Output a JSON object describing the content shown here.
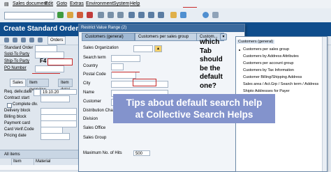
{
  "menubar": {
    "items": [
      "Sales document",
      "Edit",
      "Goto",
      "Extras",
      "Environment",
      "System",
      "Help"
    ]
  },
  "titlebar": {
    "title": "Create Standard Order: O..."
  },
  "app_toolbar": {
    "orders_label": "Orders"
  },
  "header_form": {
    "standard_order": "Standard Order",
    "sold_to": "Sold-To Party",
    "ship_to": "Ship-To Party",
    "po_number": "PO Number",
    "f4_hint": "F4"
  },
  "tabs": [
    "Sales",
    "Item overview",
    "Item detai"
  ],
  "sales_tab": {
    "req_deliv_date": "Req. deliv.date",
    "req_deliv_value": "19.10.20",
    "contract_start": "Contract start",
    "complete_dlv": "Complete dlv.",
    "delivery_block": "Delivery block",
    "billing_block": "Billing block",
    "payment_card": "Payment card",
    "card_verif_code": "Card Verif.Code",
    "pricing_date": "Pricing date"
  },
  "items_table": {
    "title": "All items",
    "columns": [
      "Item",
      "Material"
    ]
  },
  "dialog": {
    "title": "Restrict Value Range (2)",
    "tabs": [
      "Customers (general)",
      "Customers per sales group",
      "Custom..."
    ],
    "fields": [
      "Sales Organization",
      "Search term",
      "Country",
      "Postal Code",
      "City",
      "Name",
      "Customer",
      "Distribution Channel",
      "Division",
      "Sales Office",
      "Sales Group"
    ],
    "max_hits_label": "Maximum No. of Hits",
    "max_hits_value": "500"
  },
  "listbox": {
    "items": [
      "Customers (general)",
      "Customers per sales group",
      "Customers by Address Attributes",
      "Customers per account group",
      "Customers by Tax Information",
      "Customer Billing/Shipping Address",
      "Sales area / Act.Grp / Search term / Address",
      "Shipto Addresses for Payer"
    ]
  },
  "annotation": {
    "question_lines": [
      "which",
      "Tab",
      "should",
      "be the",
      "default",
      "one?"
    ],
    "banner_line1": "Tips about default search help",
    "banner_line2": "at Collective Search Helps"
  },
  "colors": {
    "title_blue": "#0f4d8c",
    "banner_purple": "#8393cc",
    "annotation_red": "#c62828"
  }
}
